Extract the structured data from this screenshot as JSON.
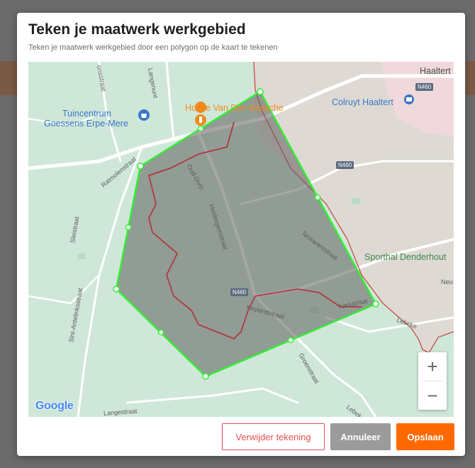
{
  "modal": {
    "title": "Teken je maatwerk werkgebied",
    "subtitle": "Teken je maatwerk werkgebied door een polygon op de kaart te tekenen"
  },
  "map": {
    "pois": {
      "tuincentrum_line1": "Tuincentrum",
      "tuincentrum_line2": "Goessens Erpe-Mere",
      "hoeve": "Hoeve Van Den Bossche",
      "colruyt": "Colruyt Haaltert",
      "haaltert": "Haaltert",
      "sporthal": "Sporthal Denderhout"
    },
    "streets": {
      "langenunt": "Langenunt",
      "onsstraat": "onsstraat",
      "ratmolenstraat": "Ratmolenstraat",
      "sleistraat": "Sleistraat",
      "sint_antelinksstraat": "Sint-Antelinksstraat",
      "oud_dorp": "Oud-Dorp",
      "heldergemstraat": "Heldergemstraat",
      "terwarentstraat": "Terwarentstraat",
      "keylandstraat": "Keylandstraat",
      "kerkstraat": "Kerkstraat",
      "groenstraat": "Groenstraat",
      "langestraat": "Langestraat",
      "lebeke": "Lebeke",
      "lebek": "Lebek",
      "neu": "Neu"
    },
    "road_shields": [
      "N460",
      "N460",
      "N460"
    ],
    "attribution": "Google",
    "zoom_in": "+",
    "zoom_out": "−",
    "colors": {
      "polygon_stroke": "#33ee33",
      "polygon_fill": "#5e5e5e",
      "boundary": "#b03a3a",
      "poi_blue": "#3a77c8",
      "poi_orange": "#f08a1c",
      "poi_green": "#3c8a4e"
    }
  },
  "buttons": {
    "delete": "Verwijder tekening",
    "cancel": "Annuleer",
    "save": "Opslaan"
  }
}
